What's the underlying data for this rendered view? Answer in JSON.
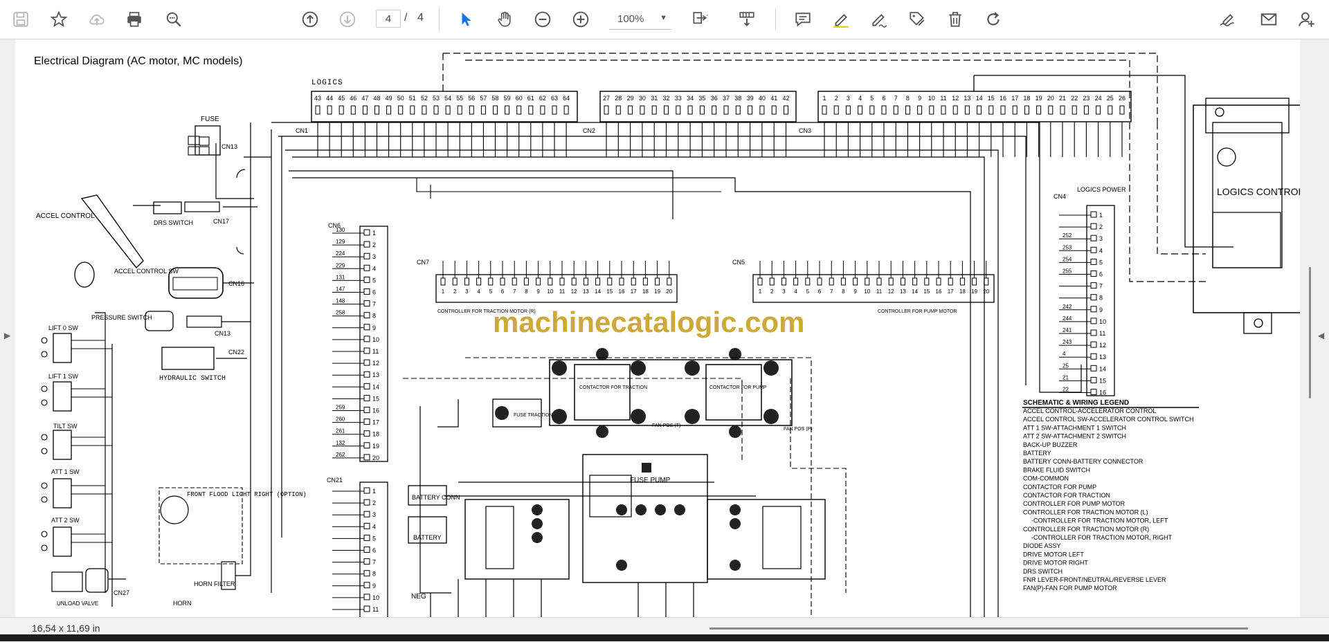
{
  "toolbar": {
    "page_current": "4",
    "page_separator": "/",
    "page_total": "4",
    "zoom_value": "100%",
    "icons": [
      "save-icon",
      "bookmark-star-icon",
      "cloud-upload-icon",
      "print-icon",
      "zoom-search-icon",
      "page-up-icon",
      "page-down-icon",
      "select-arrow-icon",
      "hand-pan-icon",
      "zoom-out-icon",
      "zoom-in-icon",
      "page-fit-icon",
      "scroll-mode-icon",
      "comment-icon",
      "highlight-pen-icon",
      "draw-pen-icon",
      "stamp-icon",
      "delete-icon",
      "rotate-icon",
      "fill-sign-icon",
      "email-icon",
      "add-user-icon"
    ]
  },
  "document": {
    "title": "Electrical Diagram (AC motor, MC models)",
    "watermark": "machinecatalogic.com",
    "logics_label": "LOGICS",
    "logics_controller_label": "LOGICS CONTROLLER",
    "logics_power_label": "LOGICS POWER",
    "cn1_label": "CN1",
    "cn2_label": "CN2",
    "cn3_label": "CN3",
    "cn4_label": "CN4",
    "cn5_label": "CN5",
    "cn6_label": "CN6",
    "cn7_label": "CN7",
    "cn21_label": "CN21",
    "cn1_pins": [
      "43",
      "44",
      "45",
      "46",
      "47",
      "48",
      "49",
      "50",
      "51",
      "52",
      "53",
      "54",
      "55",
      "56",
      "57",
      "58",
      "59",
      "60",
      "61",
      "62",
      "63",
      "64"
    ],
    "cn2_pins": [
      "27",
      "28",
      "29",
      "30",
      "31",
      "32",
      "33",
      "34",
      "35",
      "36",
      "37",
      "38",
      "39",
      "40",
      "41",
      "42"
    ],
    "cn3_pins": [
      "1",
      "2",
      "3",
      "4",
      "5",
      "6",
      "7",
      "8",
      "9",
      "10",
      "11",
      "12",
      "13",
      "14",
      "15",
      "16",
      "17",
      "18",
      "19",
      "20",
      "21",
      "22",
      "23",
      "24",
      "25",
      "26"
    ],
    "fuse_label": "FUSE",
    "accel_control": "ACCEL CONTROL",
    "accel_control_sw": "ACCEL CONTROL SW",
    "drs_switch": "DRS SWITCH",
    "pressure_switch": "PRESSURE SWITCH",
    "hydraulic_switch": "HYDRAULIC SWITCH",
    "lift0": "LIFT 0 SW",
    "lift1": "LIFT 1 SW",
    "tilt": "TILT SW",
    "att1": "ATT 1 SW",
    "att2": "ATT 2 SW",
    "front_flood": "FRONT FLOOD LIGHT RIGHT (OPTION)",
    "horn_filter": "HORN FILTER",
    "horn": "HORN",
    "unload_valve": "UNLOAD VALVE",
    "cn27": "CN27",
    "cn13": "CN13",
    "cn17": "CN17",
    "cn16": "CN16",
    "cn22": "CN22",
    "contactor_traction": "CONTACTOR FOR TRACTION",
    "contactor_pump": "CONTACTOR FOR PUMP",
    "fuse_traction": "FUSE TRACTION",
    "fuse_pump": "FUSE PUMP",
    "fan_pos_t": "FAN POS (T)",
    "fan_pos_p": "FAN POS (P)",
    "battery_conn": "BATTERY CONN",
    "battery": "BATTERY",
    "neg": "NEG",
    "controller_traction_r": "CONTROLLER FOR TRACTION MOTOR (R)",
    "controller_pump_motor": "CONTROLLER FOR PUMP MOTOR",
    "legend_title": "SCHEMATIC & WIRING LEGEND",
    "legend_items": [
      "ACCEL CONTROL-ACCELERATOR CONTROL",
      "ACCEL CONTROL SW-ACCELERATOR CONTROL SWITCH",
      "ATT 1 SW-ATTACHMENT 1 SWITCH",
      "ATT 2 SW-ATTACHMENT 2 SWITCH",
      "BACK-UP BUZZER",
      "BATTERY",
      "BATTERY CONN-BATTERY CONNECTOR",
      "BRAKE FLUID SWITCH",
      "COM-COMMON",
      "CONTACTOR FOR PUMP",
      "CONTACTOR FOR TRACTION",
      "CONTROLLER FOR PUMP MOTOR",
      "CONTROLLER FOR TRACTION MOTOR (L)",
      "-CONTROLLER FOR TRACTION MOTOR, LEFT",
      "CONTROLLER FOR TRACTION MOTOR (R)",
      "-CONTROLLER FOR TRACTION MOTOR, RIGHT",
      "DIODE ASSY",
      "DRIVE MOTOR LEFT",
      "DRIVE MOTOR RIGHT",
      "DRS SWITCH",
      "FNR LEVER-FRONT/NEUTRAL/REVERSE LEVER",
      "FAN(P)-FAN FOR PUMP MOTOR"
    ],
    "cn6_wires": [
      "130",
      "129",
      "224",
      "229",
      "131",
      "147",
      "148",
      "258",
      "",
      "",
      "",
      "",
      "",
      "",
      "",
      "259",
      "260",
      "261",
      "132",
      "262"
    ],
    "cn4_wires": [
      "",
      "",
      "252",
      "253",
      "254",
      "255",
      "",
      "",
      "242",
      "244",
      "241",
      "243",
      "4",
      "25",
      "21",
      "22"
    ]
  },
  "status": {
    "dimensions": "16,54 x 11,69 in"
  }
}
